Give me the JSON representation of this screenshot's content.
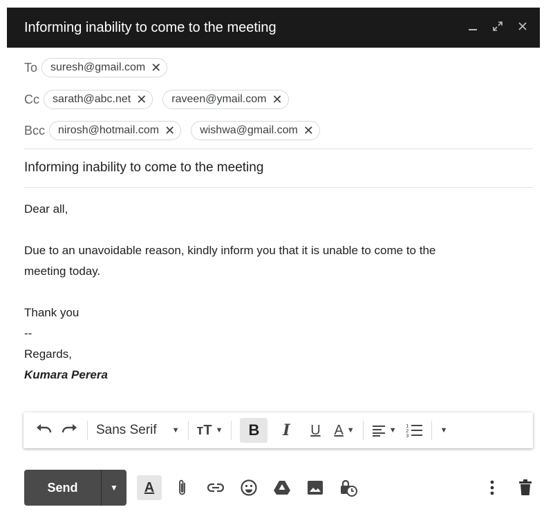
{
  "window": {
    "title": "Informing inability to come to the meeting",
    "controls": [
      "minimize-icon",
      "expand-icon",
      "close-icon"
    ]
  },
  "recipients": {
    "to": {
      "label": "To",
      "chips": [
        "suresh@gmail.com"
      ]
    },
    "cc": {
      "label": "Cc",
      "chips": [
        "sarath@abc.net",
        "raveen@ymail.com"
      ]
    },
    "bcc": {
      "label": "Bcc",
      "chips": [
        "nirosh@hotmail.com",
        "wishwa@gmail.com"
      ]
    },
    "remove_glyph": "✕"
  },
  "subject": "Informing inability to come to the meeting",
  "body": {
    "greeting": "Dear all,",
    "paragraph_line1": "Due to an unavoidable reason, kindly inform you that it is unable to come to the",
    "paragraph_line2": "meeting today.",
    "closing": "Thank you",
    "dashes": "--",
    "regards": "Regards,",
    "signature": "Kumara Perera"
  },
  "format_toolbar": {
    "font_family": "Sans Serif",
    "bold_label": "B",
    "italic_label": "I",
    "underline_label": "U",
    "text_color_label": "A",
    "size_label": "тT",
    "icons": [
      "undo-icon",
      "redo-icon",
      "text-size-icon",
      "bold-icon",
      "italic-icon",
      "underline-icon",
      "text-color-icon",
      "align-icon",
      "numbered-list-icon",
      "more-formatting-icon"
    ]
  },
  "actions": {
    "send_label": "Send",
    "formatting_label": "A",
    "icons": [
      "formatting-options-icon",
      "attach-icon",
      "link-icon",
      "emoji-icon",
      "drive-icon",
      "photo-icon",
      "confidential-mode-icon",
      "more-options-icon",
      "discard-icon"
    ]
  }
}
